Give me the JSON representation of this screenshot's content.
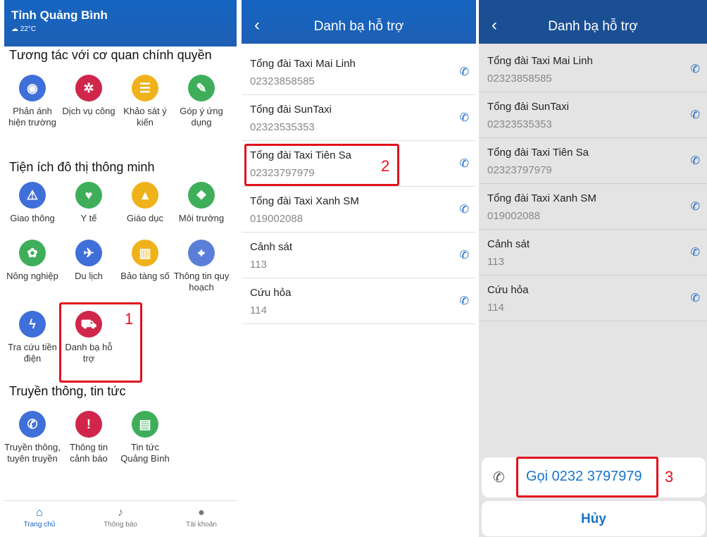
{
  "home": {
    "city": "Tỉnh Quảng Bình",
    "weather": "☁ 22°C",
    "sections": [
      {
        "title": "Tương tác với cơ quan chính quyền"
      },
      {
        "title": "Tiện ích đô thị thông minh"
      },
      {
        "title": "Truyền thông, tin tức"
      }
    ],
    "tiles": [
      {
        "label": "Phản ánh hiện trường",
        "icon": "camera-icon",
        "glyph": "◉",
        "color": "#3f6fd8"
      },
      {
        "label": "Dịch vụ công",
        "icon": "service-icon",
        "glyph": "✲",
        "color": "#d0264a"
      },
      {
        "label": "Khảo sát ý kiến",
        "icon": "survey-icon",
        "glyph": "☰",
        "color": "#f0b21b"
      },
      {
        "label": "Góp ý ứng dụng",
        "icon": "feedback-icon",
        "glyph": "✎",
        "color": "#3fae5a"
      },
      {
        "label": "Giao thông",
        "icon": "traffic-icon",
        "glyph": "⚠",
        "color": "#3f6fd8"
      },
      {
        "label": "Y tế",
        "icon": "health-icon",
        "glyph": "♥",
        "color": "#3fae5a"
      },
      {
        "label": "Giáo dục",
        "icon": "education-icon",
        "glyph": "▲",
        "color": "#f0b21b"
      },
      {
        "label": "Môi trường",
        "icon": "environment-icon",
        "glyph": "❖",
        "color": "#3fae5a"
      },
      {
        "label": "Nông nghiệp",
        "icon": "agriculture-icon",
        "glyph": "✿",
        "color": "#3fae5a"
      },
      {
        "label": "Du lịch",
        "icon": "travel-icon",
        "glyph": "✈",
        "color": "#3f6fd8"
      },
      {
        "label": "Bảo tàng số",
        "icon": "museum-icon",
        "glyph": "▥",
        "color": "#f0b21b"
      },
      {
        "label": "Thông tin quy hoạch",
        "icon": "map-icon",
        "glyph": "⌖",
        "color": "#5b7fd8"
      },
      {
        "label": "Tra cứu tiền điện",
        "icon": "electricity-icon",
        "glyph": "ϟ",
        "color": "#3f6fd8"
      },
      {
        "label": "Danh bạ hỗ trợ",
        "icon": "taxi-icon",
        "glyph": "⛟",
        "color": "#d0264a"
      },
      {
        "label": "Truyền thông, tuyên truyền",
        "icon": "megaphone-icon",
        "glyph": "✆",
        "color": "#3f6fd8"
      },
      {
        "label": "Thông tin cảnh báo",
        "icon": "warning-icon",
        "glyph": "!",
        "color": "#d0264a"
      },
      {
        "label": "Tin tức Quảng Bình",
        "icon": "news-icon",
        "glyph": "▤",
        "color": "#3fae5a"
      }
    ],
    "tabs": [
      {
        "label": "Trang chủ",
        "icon": "home-icon",
        "glyph": "⌂"
      },
      {
        "label": "Thông báo",
        "icon": "bell-icon",
        "glyph": "♪"
      },
      {
        "label": "Tài khoản",
        "icon": "user-icon",
        "glyph": "●"
      }
    ]
  },
  "directory": {
    "title": "Danh bạ hỗ trợ",
    "back": "‹",
    "contacts": [
      {
        "name": "Tổng đài Taxi Mai Linh",
        "phone": "02323858585"
      },
      {
        "name": "Tổng đài SunTaxi",
        "phone": "02323535353"
      },
      {
        "name": "Tổng đài Taxi Tiên Sa",
        "phone": "02323797979"
      },
      {
        "name": "Tổng đài Taxi Xanh SM",
        "phone": "019002088"
      },
      {
        "name": "Cảnh sát",
        "phone": "113"
      },
      {
        "name": "Cứu hỏa",
        "phone": "114"
      }
    ]
  },
  "call_sheet": {
    "call_label": "Gọi 0232 3797979",
    "cancel_label": "Hủy"
  },
  "steps": [
    "1",
    "2",
    "3"
  ],
  "colors": {
    "primary": "#1565c0",
    "highlight": "#e3101e"
  }
}
